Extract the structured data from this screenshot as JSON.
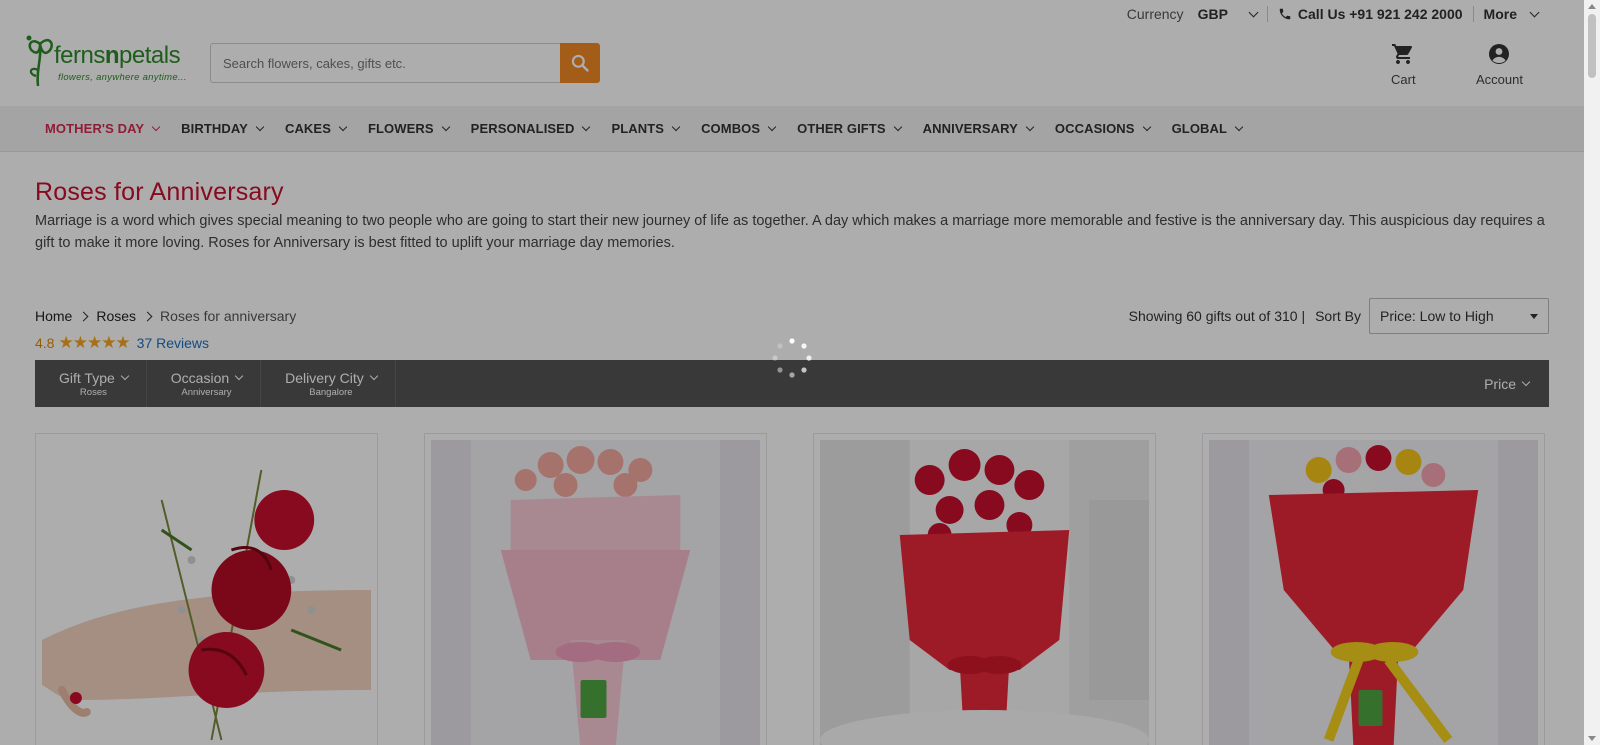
{
  "topbar": {
    "currency_label": "Currency",
    "currency_value": "GBP",
    "call_label": "Call Us +91 921 242 2000",
    "more_label": "More"
  },
  "header": {
    "logo_brand_a": "ferns",
    "logo_brand_b": "n",
    "logo_brand_c": "petals",
    "logo_tagline": "flowers, anywhere anytime...",
    "search_placeholder": "Search flowers, cakes, gifts etc.",
    "cart_label": "Cart",
    "account_label": "Account"
  },
  "nav": {
    "items": [
      {
        "label": "MOTHER'S DAY"
      },
      {
        "label": "BIRTHDAY"
      },
      {
        "label": "CAKES"
      },
      {
        "label": "FLOWERS"
      },
      {
        "label": "PERSONALISED"
      },
      {
        "label": "PLANTS"
      },
      {
        "label": "COMBOS"
      },
      {
        "label": "OTHER GIFTS"
      },
      {
        "label": "ANNIVERSARY"
      },
      {
        "label": "OCCASIONS"
      },
      {
        "label": "GLOBAL"
      }
    ]
  },
  "page": {
    "title": "Roses for Anniversary",
    "description": "Marriage is a word which gives special meaning to two people who are going to start their new journey of life as together. A day which makes a marriage more memorable and festive is the anniversary day. This auspicious day requires a gift to make it more loving. Roses for Anniversary is best fitted to uplift your marriage day memories."
  },
  "breadcrumb": {
    "items": [
      "Home",
      "Roses",
      "Roses for anniversary"
    ]
  },
  "rating": {
    "value": "4.8",
    "stars": "★★★★★",
    "count": "37",
    "reviews_label": "Reviews"
  },
  "sort": {
    "showing": "Showing 60 gifts out of 310 |",
    "sort_label": "Sort By",
    "selected": "Price: Low to High"
  },
  "filters": {
    "items": [
      {
        "title": "Gift Type",
        "sub": "Roses"
      },
      {
        "title": "Occasion",
        "sub": "Anniversary"
      },
      {
        "title": "Delivery City",
        "sub": "Bangalore"
      }
    ],
    "price_label": "Price"
  },
  "colors": {
    "accent": "#d32b4f",
    "title": "#c8102e",
    "search_button": "#f08a24",
    "filter_bar": "#555555",
    "brand_green": "#2f8a2c"
  }
}
